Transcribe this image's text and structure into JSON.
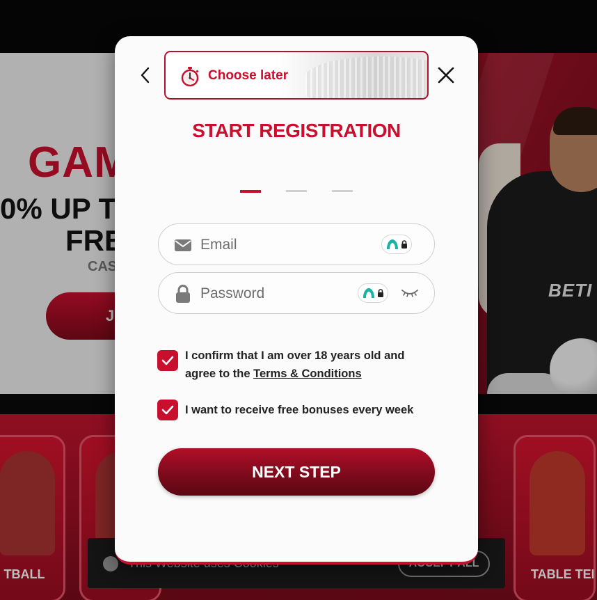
{
  "modal": {
    "choose_later_label": "Choose later",
    "title": "START REGISTRATION",
    "steps": {
      "total": 3,
      "current": 1
    },
    "email": {
      "placeholder": "Email",
      "value": ""
    },
    "password": {
      "placeholder": "Password",
      "value": ""
    },
    "age_confirm": {
      "checked": true,
      "text_before": "I confirm that I am over 18 years old and agree to the ",
      "link_text": "Terms & Conditions"
    },
    "bonus_optin": {
      "checked": true,
      "text": "I want to receive free bonuses every week"
    },
    "next_button_label": "NEXT STEP",
    "icons": {
      "back": "chevron-left-icon",
      "close": "close-icon",
      "timer": "stopwatch-icon",
      "email": "envelope-icon",
      "password": "lock-icon",
      "password_manager": "password-manager-icon",
      "toggle_visibility": "eye-closed-icon",
      "check": "checkmark-icon"
    },
    "colors": {
      "accent": "#c8102e",
      "button_dark": "#7a0a1b",
      "badge_teal": "#19b3a3"
    }
  },
  "background": {
    "hero_title": "GAM",
    "hero_line1": "0% UP T",
    "hero_line2": "FRE",
    "hero_line3": "CAS",
    "hero_join": "J",
    "brand": "BETI",
    "cards": [
      "TBALL",
      "TABLE TEN"
    ],
    "cookie_text": "This Website uses Cookies",
    "cookie_accept": "ACCEPT ALL"
  }
}
